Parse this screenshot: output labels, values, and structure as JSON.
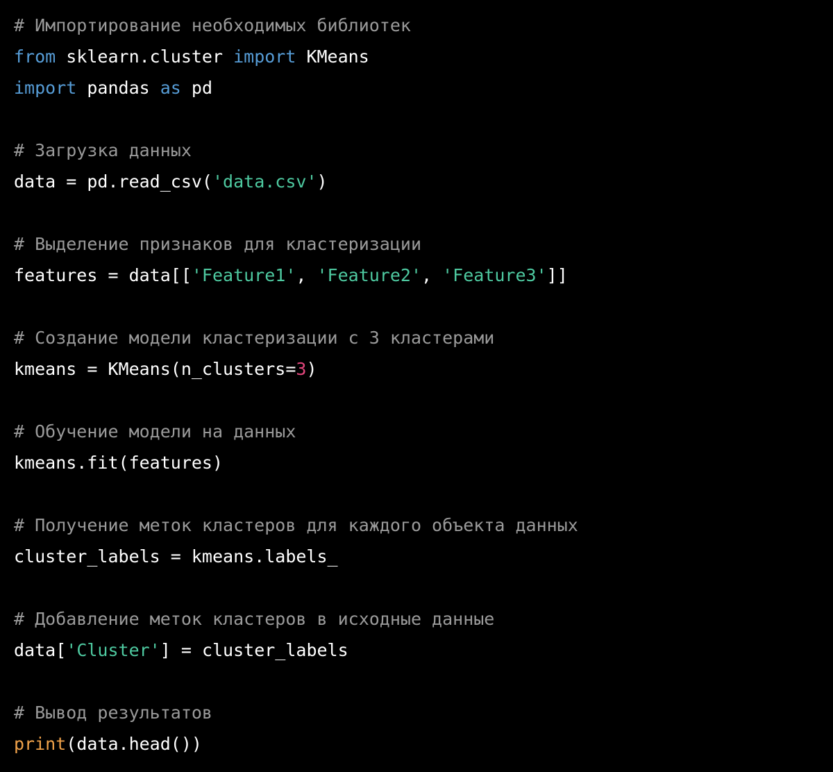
{
  "code": {
    "language": "python",
    "colors": {
      "background": "#000000",
      "plain": "#ffffff",
      "comment": "#9a9a9a",
      "keyword": "#569cd6",
      "string": "#4ec9a0",
      "number": "#e0457b",
      "builtin": "#f0a24a"
    },
    "lines": [
      [
        {
          "t": "comment",
          "v": "# Импортирование необходимых библиотек"
        }
      ],
      [
        {
          "t": "keyword",
          "v": "from"
        },
        {
          "t": "plain",
          "v": " sklearn.cluster "
        },
        {
          "t": "keyword",
          "v": "import"
        },
        {
          "t": "plain",
          "v": " KMeans"
        }
      ],
      [
        {
          "t": "keyword",
          "v": "import"
        },
        {
          "t": "plain",
          "v": " pandas "
        },
        {
          "t": "keyword",
          "v": "as"
        },
        {
          "t": "plain",
          "v": " pd"
        }
      ],
      [],
      [
        {
          "t": "comment",
          "v": "# Загрузка данных"
        }
      ],
      [
        {
          "t": "plain",
          "v": "data = pd.read_csv("
        },
        {
          "t": "string",
          "v": "'data.csv'"
        },
        {
          "t": "plain",
          "v": ")"
        }
      ],
      [],
      [
        {
          "t": "comment",
          "v": "# Выделение признаков для кластеризации"
        }
      ],
      [
        {
          "t": "plain",
          "v": "features = data[["
        },
        {
          "t": "string",
          "v": "'Feature1'"
        },
        {
          "t": "plain",
          "v": ", "
        },
        {
          "t": "string",
          "v": "'Feature2'"
        },
        {
          "t": "plain",
          "v": ", "
        },
        {
          "t": "string",
          "v": "'Feature3'"
        },
        {
          "t": "plain",
          "v": "]]"
        }
      ],
      [],
      [
        {
          "t": "comment",
          "v": "# Создание модели кластеризации с 3 кластерами"
        }
      ],
      [
        {
          "t": "plain",
          "v": "kmeans = KMeans(n_clusters="
        },
        {
          "t": "number",
          "v": "3"
        },
        {
          "t": "plain",
          "v": ")"
        }
      ],
      [],
      [
        {
          "t": "comment",
          "v": "# Обучение модели на данных"
        }
      ],
      [
        {
          "t": "plain",
          "v": "kmeans.fit(features)"
        }
      ],
      [],
      [
        {
          "t": "comment",
          "v": "# Получение меток кластеров для каждого объекта данных"
        }
      ],
      [
        {
          "t": "plain",
          "v": "cluster_labels = kmeans.labels_"
        }
      ],
      [],
      [
        {
          "t": "comment",
          "v": "# Добавление меток кластеров в исходные данные"
        }
      ],
      [
        {
          "t": "plain",
          "v": "data["
        },
        {
          "t": "string",
          "v": "'Cluster'"
        },
        {
          "t": "plain",
          "v": "] = cluster_labels"
        }
      ],
      [],
      [
        {
          "t": "comment",
          "v": "# Вывод результатов"
        }
      ],
      [
        {
          "t": "builtin",
          "v": "print"
        },
        {
          "t": "plain",
          "v": "(data.head())"
        }
      ]
    ]
  }
}
